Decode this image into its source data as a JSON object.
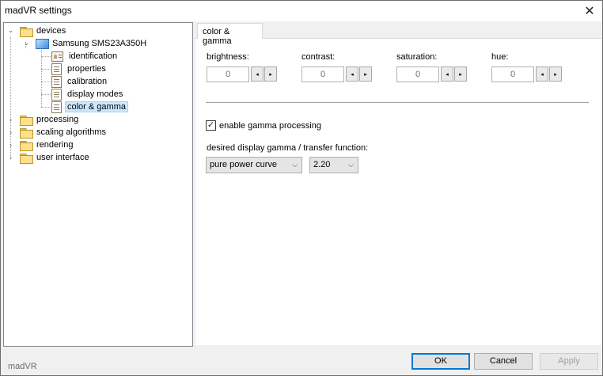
{
  "window": {
    "title": "madVR settings",
    "close_glyph": "✕"
  },
  "tree": {
    "devices": "devices",
    "device": "Samsung SMS23A350H",
    "children": [
      "identification",
      "properties",
      "calibration",
      "display modes",
      "color & gamma"
    ],
    "selected": "color & gamma",
    "roots": [
      "processing",
      "scaling algorithms",
      "rendering",
      "user interface"
    ]
  },
  "tab": {
    "label": "color & gamma"
  },
  "adjust": {
    "brightness_label": "brightness:",
    "brightness_value": "0",
    "contrast_label": "contrast:",
    "contrast_value": "0",
    "saturation_label": "saturation:",
    "saturation_value": "0",
    "hue_label": "hue:",
    "hue_value": "0",
    "left_glyph": "◂",
    "right_glyph": "▸"
  },
  "gamma": {
    "enable_label": "enable gamma processing",
    "enabled": true,
    "check_glyph": "✓",
    "desired_label": "desired display gamma / transfer function:",
    "curve_value": "pure power curve",
    "gamma_value": "2.20",
    "chevron_glyph": "⌵"
  },
  "footer": {
    "label": "madVR",
    "ok": "OK",
    "cancel": "Cancel",
    "apply": "Apply"
  },
  "colors": {
    "selection_bg": "#cce8ff",
    "selection_border": "#99d1ff",
    "primary_button_border": "#0078d7"
  }
}
